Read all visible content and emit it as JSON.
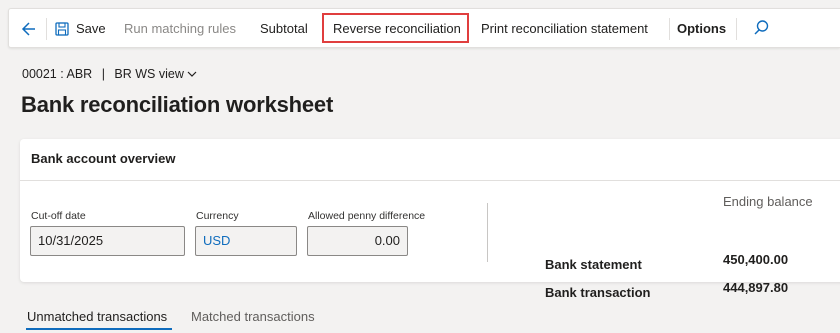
{
  "toolbar": {
    "save": "Save",
    "run_matching_rules": "Run matching rules",
    "subtotal": "Subtotal",
    "reverse_reconciliation": "Reverse reconciliation",
    "print_statement": "Print reconciliation statement",
    "options": "Options"
  },
  "breadcrumb": {
    "record": "00021 : ABR",
    "separator": "|",
    "view": "BR WS view"
  },
  "page_title": "Bank reconciliation worksheet",
  "overview": {
    "title": "Bank account overview",
    "cutoff_label": "Cut-off date",
    "cutoff_value": "10/31/2025",
    "currency_label": "Currency",
    "currency_value": "USD",
    "penny_label": "Allowed penny difference",
    "penny_value": "0.00",
    "ending_balance_header": "Ending balance",
    "rows": [
      {
        "label": "Bank statement",
        "amount": "450,400.00"
      },
      {
        "label": "Bank transaction",
        "amount": "444,897.80"
      }
    ]
  },
  "tabs": {
    "unmatched": "Unmatched transactions",
    "matched": "Matched transactions"
  },
  "colors": {
    "accent": "#0f6cbd",
    "highlight": "#e03e3e",
    "link_value": "#0f6cbd"
  }
}
